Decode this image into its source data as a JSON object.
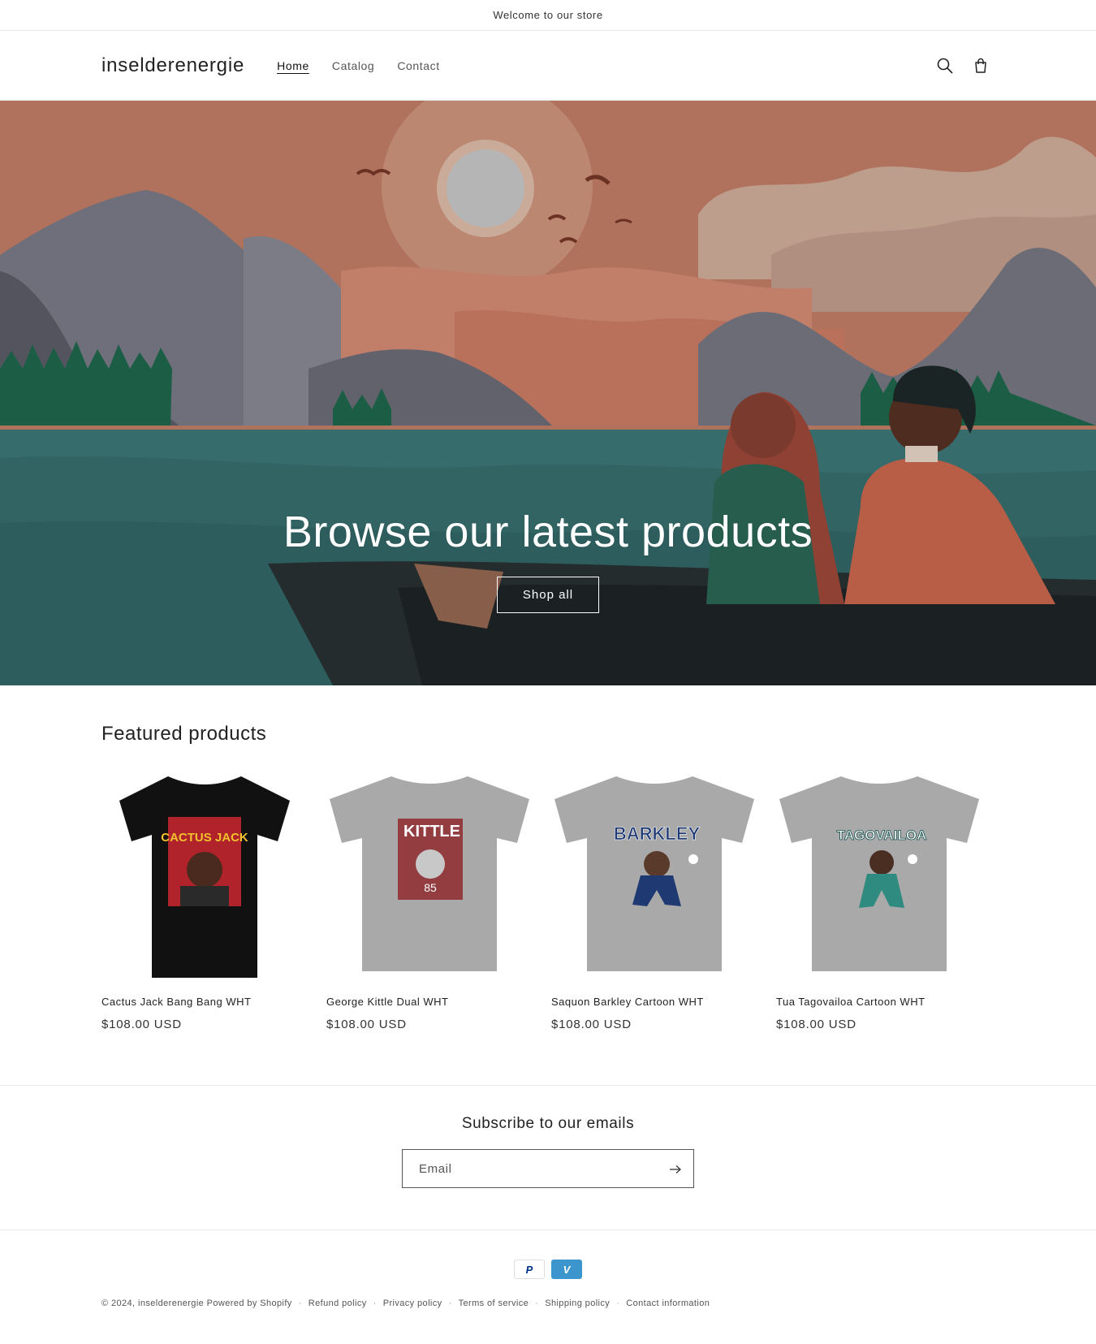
{
  "announcement": {
    "text": "Welcome to our store"
  },
  "header": {
    "logo": "inselderenergie",
    "nav": [
      {
        "label": "Home"
      },
      {
        "label": "Catalog"
      },
      {
        "label": "Contact"
      }
    ],
    "icons": [
      "search-icon",
      "cart-icon"
    ]
  },
  "hero": {
    "title": "Browse our latest products",
    "button": "Shop all"
  },
  "featured": {
    "heading": "Featured products",
    "products": [
      {
        "title": "Cactus Jack Bang Bang WHT",
        "price": "$108.00 USD",
        "shirt_color": "#111111",
        "print_text": "CACTUS JACK"
      },
      {
        "title": "George Kittle Dual WHT",
        "price": "$108.00 USD",
        "shirt_color": "#a9a9a9",
        "print_text": "KITTLE"
      },
      {
        "title": "Saquon Barkley Cartoon WHT",
        "price": "$108.00 USD",
        "shirt_color": "#a9a9a9",
        "print_text": "BARKLEY"
      },
      {
        "title": "Tua Tagovailoa Cartoon WHT",
        "price": "$108.00 USD",
        "shirt_color": "#a9a9a9",
        "print_text": "TAGOVAILOA"
      }
    ]
  },
  "newsletter": {
    "heading": "Subscribe to our emails",
    "placeholder": "Email"
  },
  "footer": {
    "payment_icons": [
      "paypal-icon",
      "venmo-icon"
    ],
    "paypal_glyph": "P",
    "venmo_glyph": "V",
    "copyright": "© 2024,",
    "store_name": "inselderenergie",
    "powered": "Powered by Shopify",
    "policies": [
      "Refund policy",
      "Privacy policy",
      "Terms of service",
      "Shipping policy",
      "Contact information"
    ]
  },
  "colors": {
    "hero_sky": "#d98a6a",
    "hero_water": "#3f7b7b",
    "venmo": "#3d95ce",
    "paypal": "#003087"
  }
}
